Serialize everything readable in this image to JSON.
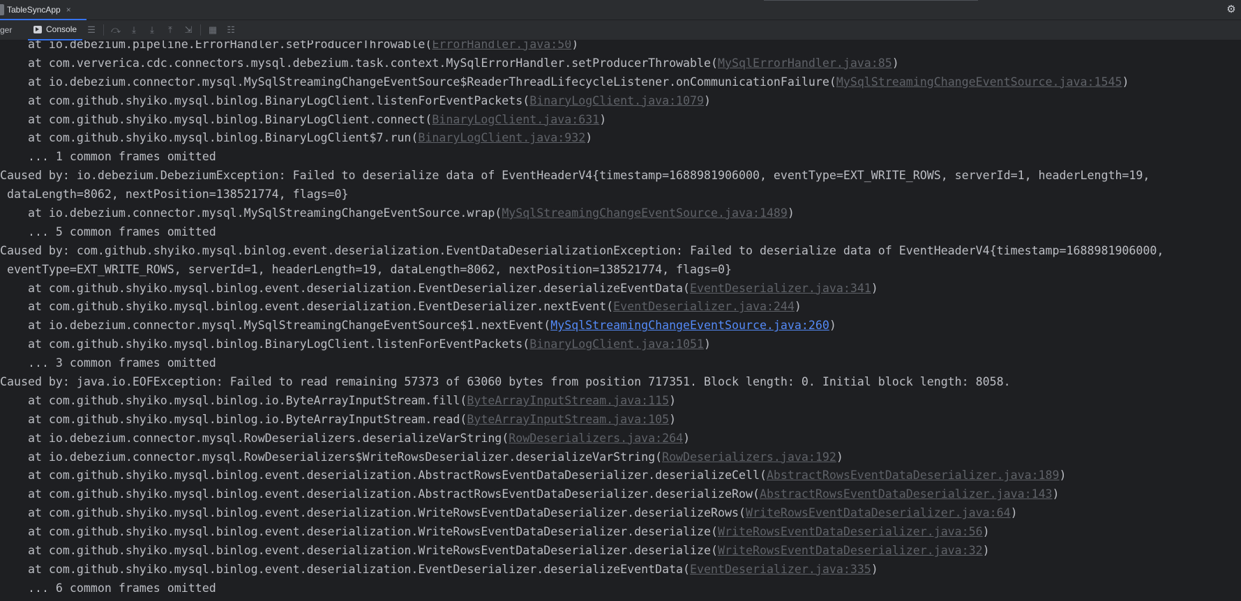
{
  "window": {
    "run_tab_label": "TableSyncApp",
    "close_glyph": "×",
    "gear_icon": "gear-icon"
  },
  "toolbar": {
    "debugger_label": "ger",
    "console_label": "Console",
    "buttons": [
      "soft-wrap-icon",
      "restore-frames-icon",
      "step-over-icon",
      "step-into-icon",
      "force-step-into-icon",
      "step-out-icon",
      "run-to-cursor-icon",
      "evaluate-icon",
      "layout-icon"
    ]
  },
  "console": {
    "lines": [
      {
        "text": "    at io.debezium.pipeline.ErrorHandler.setProducerThrowable(",
        "link": "ErrorHandler.java:50",
        "tail": ")"
      },
      {
        "text": "    at com.ververica.cdc.connectors.mysql.debezium.task.context.MySqlErrorHandler.setProducerThrowable(",
        "link": "MySqlErrorHandler.java:85",
        "tail": ")"
      },
      {
        "text": "    at io.debezium.connector.mysql.MySqlStreamingChangeEventSource$ReaderThreadLifecycleListener.onCommunicationFailure(",
        "link": "MySqlStreamingChangeEventSource.java:1545",
        "tail": ")"
      },
      {
        "text": "    at com.github.shyiko.mysql.binlog.BinaryLogClient.listenForEventPackets(",
        "link": "BinaryLogClient.java:1079",
        "tail": ")"
      },
      {
        "text": "    at com.github.shyiko.mysql.binlog.BinaryLogClient.connect(",
        "link": "BinaryLogClient.java:631",
        "tail": ")"
      },
      {
        "text": "    at com.github.shyiko.mysql.binlog.BinaryLogClient$7.run(",
        "link": "BinaryLogClient.java:932",
        "tail": ")"
      },
      {
        "text": "    ... 1 common frames omitted",
        "link": "",
        "tail": ""
      },
      {
        "text": "Caused by: io.debezium.DebeziumException: Failed to deserialize data of EventHeaderV4{timestamp=1688981906000, eventType=EXT_WRITE_ROWS, serverId=1, headerLength=19,",
        "link": "",
        "tail": ""
      },
      {
        "text": " dataLength=8062, nextPosition=138521774, flags=0}",
        "link": "",
        "tail": ""
      },
      {
        "text": "    at io.debezium.connector.mysql.MySqlStreamingChangeEventSource.wrap(",
        "link": "MySqlStreamingChangeEventSource.java:1489",
        "tail": ")"
      },
      {
        "text": "    ... 5 common frames omitted",
        "link": "",
        "tail": ""
      },
      {
        "text": "Caused by: com.github.shyiko.mysql.binlog.event.deserialization.EventDataDeserializationException: Failed to deserialize data of EventHeaderV4{timestamp=1688981906000,",
        "link": "",
        "tail": ""
      },
      {
        "text": " eventType=EXT_WRITE_ROWS, serverId=1, headerLength=19, dataLength=8062, nextPosition=138521774, flags=0}",
        "link": "",
        "tail": ""
      },
      {
        "text": "    at com.github.shyiko.mysql.binlog.event.deserialization.EventDeserializer.deserializeEventData(",
        "link": "EventDeserializer.java:341",
        "tail": ")"
      },
      {
        "text": "    at com.github.shyiko.mysql.binlog.event.deserialization.EventDeserializer.nextEvent(",
        "link": "EventDeserializer.java:244",
        "tail": ")"
      },
      {
        "text": "    at io.debezium.connector.mysql.MySqlStreamingChangeEventSource$1.nextEvent(",
        "link": "MySqlStreamingChangeEventSource.java:260",
        "tail": ")",
        "highlight": true
      },
      {
        "text": "    at com.github.shyiko.mysql.binlog.BinaryLogClient.listenForEventPackets(",
        "link": "BinaryLogClient.java:1051",
        "tail": ")"
      },
      {
        "text": "    ... 3 common frames omitted",
        "link": "",
        "tail": ""
      },
      {
        "text": "Caused by: java.io.EOFException: Failed to read remaining 57373 of 63060 bytes from position 717351. Block length: 0. Initial block length: 8058.",
        "link": "",
        "tail": ""
      },
      {
        "text": "    at com.github.shyiko.mysql.binlog.io.ByteArrayInputStream.fill(",
        "link": "ByteArrayInputStream.java:115",
        "tail": ")"
      },
      {
        "text": "    at com.github.shyiko.mysql.binlog.io.ByteArrayInputStream.read(",
        "link": "ByteArrayInputStream.java:105",
        "tail": ")"
      },
      {
        "text": "    at io.debezium.connector.mysql.RowDeserializers.deserializeVarString(",
        "link": "RowDeserializers.java:264",
        "tail": ")"
      },
      {
        "text": "    at io.debezium.connector.mysql.RowDeserializers$WriteRowsDeserializer.deserializeVarString(",
        "link": "RowDeserializers.java:192",
        "tail": ")"
      },
      {
        "text": "    at com.github.shyiko.mysql.binlog.event.deserialization.AbstractRowsEventDataDeserializer.deserializeCell(",
        "link": "AbstractRowsEventDataDeserializer.java:189",
        "tail": ")"
      },
      {
        "text": "    at com.github.shyiko.mysql.binlog.event.deserialization.AbstractRowsEventDataDeserializer.deserializeRow(",
        "link": "AbstractRowsEventDataDeserializer.java:143",
        "tail": ")"
      },
      {
        "text": "    at com.github.shyiko.mysql.binlog.event.deserialization.WriteRowsEventDataDeserializer.deserializeRows(",
        "link": "WriteRowsEventDataDeserializer.java:64",
        "tail": ")"
      },
      {
        "text": "    at com.github.shyiko.mysql.binlog.event.deserialization.WriteRowsEventDataDeserializer.deserialize(",
        "link": "WriteRowsEventDataDeserializer.java:56",
        "tail": ")"
      },
      {
        "text": "    at com.github.shyiko.mysql.binlog.event.deserialization.WriteRowsEventDataDeserializer.deserialize(",
        "link": "WriteRowsEventDataDeserializer.java:32",
        "tail": ")"
      },
      {
        "text": "    at com.github.shyiko.mysql.binlog.event.deserialization.EventDeserializer.deserializeEventData(",
        "link": "EventDeserializer.java:335",
        "tail": ")"
      },
      {
        "text": "    ... 6 common frames omitted",
        "link": "",
        "tail": ""
      }
    ]
  },
  "colors": {
    "console_bg": "#1e1f22",
    "text": "#bcbec4",
    "link": "#5f6268",
    "active_link": "#548af7",
    "accent": "#3574f0"
  }
}
